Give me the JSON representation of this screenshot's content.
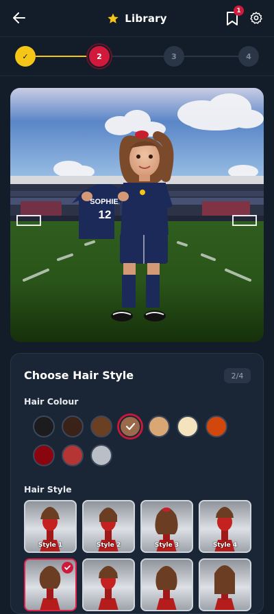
{
  "header": {
    "title": "Library",
    "bookmark_count": "1",
    "icons": [
      "back-arrow-icon",
      "star-icon",
      "bookmark-icon",
      "gear-icon"
    ]
  },
  "stepper": {
    "steps": [
      {
        "label": "✓",
        "state": "done"
      },
      {
        "label": "2",
        "state": "active"
      },
      {
        "label": "3",
        "state": "todo"
      },
      {
        "label": "4",
        "state": "todo"
      }
    ]
  },
  "preview": {
    "jersey_name": "SOPHIE",
    "jersey_number": "12"
  },
  "hair_card": {
    "title": "Choose Hair Style",
    "page": "2/4",
    "colour_label": "Hair Colour",
    "style_label": "Hair Style",
    "colours": [
      "#1c1c1e",
      "#3b2219",
      "#6b3f22",
      "#9b6a4a",
      "#d9a774",
      "#f4e3bd",
      "#d2480c",
      "#8a0510",
      "#b53534",
      "#b9bec7"
    ],
    "selected_colour_index": 3,
    "styles": [
      {
        "label": "Style 1",
        "selected": false
      },
      {
        "label": "Style 2",
        "selected": false
      },
      {
        "label": "Style 3",
        "selected": false
      },
      {
        "label": "Style 4",
        "selected": false
      },
      {
        "label": "",
        "selected": true
      },
      {
        "label": "",
        "selected": false
      },
      {
        "label": "",
        "selected": false
      },
      {
        "label": "",
        "selected": false
      }
    ]
  },
  "colors": {
    "background": "#131c29",
    "accent_red": "#d11a3b",
    "accent_yellow": "#f5c518"
  }
}
